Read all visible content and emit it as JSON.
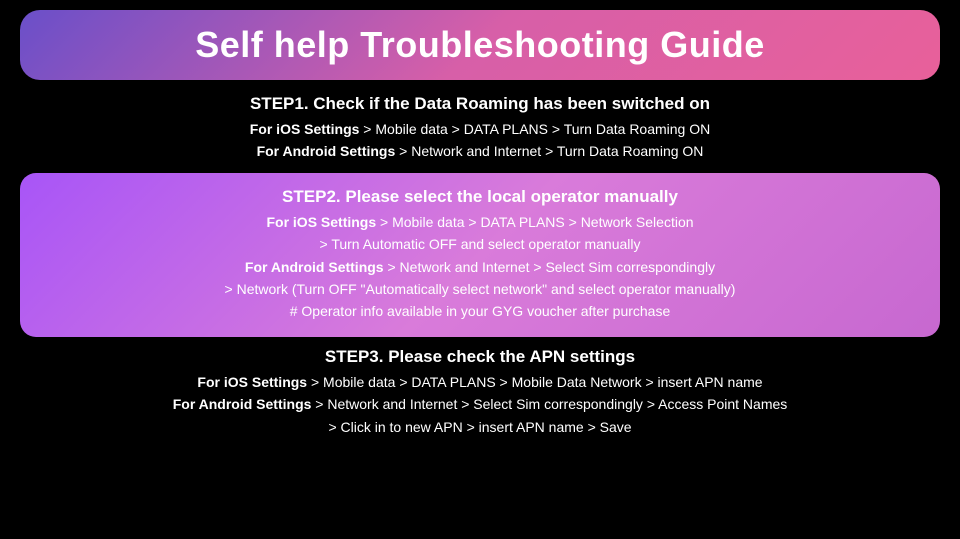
{
  "title": "Self help Troubleshooting Guide",
  "step1": {
    "title": "STEP1. Check if the Data Roaming has been switched on",
    "line1_bold": "For iOS Settings",
    "line1_rest": " > Mobile data > DATA PLANS > Turn Data Roaming ON",
    "line2_bold": "For Android Settings",
    "line2_rest": " > Network and Internet > Turn Data Roaming ON"
  },
  "step2": {
    "title": "STEP2. Please select the local operator manually",
    "line1_bold": "For iOS Settings",
    "line1_rest": " > Mobile data > DATA PLANS > Network Selection",
    "line2": "> Turn Automatic OFF and select operator manually",
    "line3_bold": "For Android Settings",
    "line3_rest": " > Network and Internet > Select Sim correspondingly",
    "line4": "> Network (Turn OFF \"Automatically select network\" and select operator manually)",
    "line5": "# Operator info available in your GYG voucher after purchase"
  },
  "step3": {
    "title": "STEP3. Please check the APN settings",
    "line1_bold": "For iOS Settings",
    "line1_rest": " > Mobile data > DATA PLANS > Mobile Data Network > insert APN name",
    "line2_bold": "For Android Settings",
    "line2_rest": " > Network and Internet > Select Sim correspondingly > Access Point Names",
    "line3": "> Click in to new APN > insert APN name > Save"
  }
}
